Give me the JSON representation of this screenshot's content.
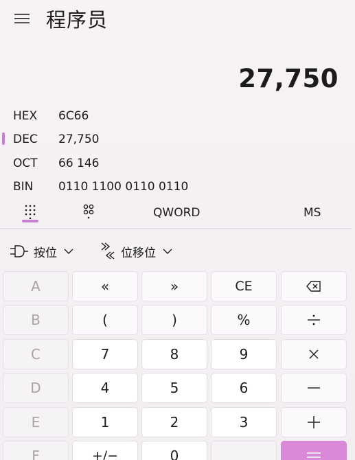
{
  "header": {
    "title": "程序员"
  },
  "display": {
    "value": "27,750"
  },
  "radix": [
    {
      "name": "HEX",
      "value": "6C66",
      "selected": false
    },
    {
      "name": "DEC",
      "value": "27,750",
      "selected": true
    },
    {
      "name": "OCT",
      "value": "66 146",
      "selected": false
    },
    {
      "name": "BIN",
      "value": "0110 1100 0110 0110",
      "selected": false
    }
  ],
  "tabs": {
    "word_size": "QWORD",
    "memory_store": "MS"
  },
  "dropdowns": {
    "bitwise": "按位",
    "bitshift": "位移位"
  },
  "keys": {
    "a": "A",
    "b": "B",
    "c": "C",
    "d": "D",
    "e": "E",
    "f": "F",
    "lshift": "«",
    "rshift": "»",
    "ce": "CE",
    "lparen": "(",
    "rparen": ")",
    "percent": "%",
    "seven": "7",
    "eight": "8",
    "nine": "9",
    "four": "4",
    "five": "5",
    "six": "6",
    "one": "1",
    "two": "2",
    "three": "3",
    "negate": "+/−",
    "zero": "0",
    "decimal": ""
  },
  "colors": {
    "accent": "#d88ad8",
    "indicator": "#c77fd2",
    "background": "#f3eff3"
  }
}
